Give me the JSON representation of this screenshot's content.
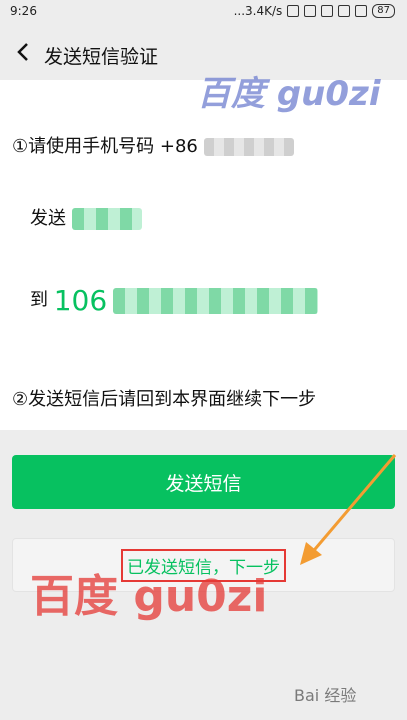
{
  "status_bar": {
    "time": "9:26",
    "speed": "...3.4K/s",
    "battery": "87"
  },
  "header": {
    "title": "发送短信验证"
  },
  "content": {
    "step1_prefix": "①请使用手机号码 +86",
    "send_label": "发送",
    "to_label": "到",
    "to_number_prefix": "106",
    "step2": "②发送短信后请回到本界面继续下一步"
  },
  "buttons": {
    "send_sms": "发送短信",
    "next": "已发送短信，下一步"
  },
  "watermarks": {
    "top": "百度 gu0zi",
    "bottom": "百度 gu0zi",
    "footer": "Bai 经验"
  },
  "colors": {
    "accent": "#07c160",
    "annotation": "#e53935",
    "background": "#ededed"
  }
}
